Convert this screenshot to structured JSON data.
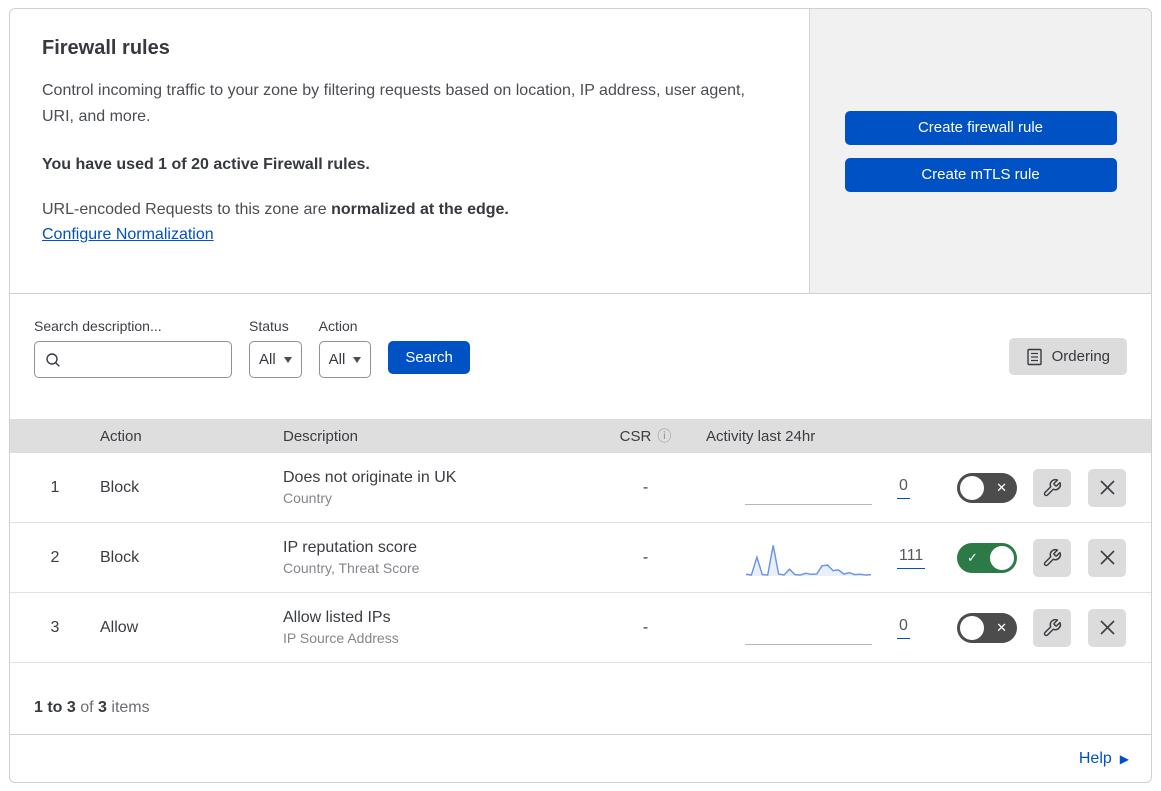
{
  "header": {
    "title": "Firewall rules",
    "description": "Control incoming traffic to your zone by filtering requests based on location, IP address, user agent, URI, and more.",
    "usage": "You have used 1 of 20 active Firewall rules.",
    "normalization_prefix": "URL-encoded Requests to this zone are",
    "normalization_bold": "normalized at the edge.",
    "normalization_link": "Configure Normalization",
    "create_firewall_button": "Create firewall rule",
    "create_mtls_button": "Create mTLS rule"
  },
  "filters": {
    "search_label": "Search description...",
    "search_value": "",
    "status_label": "Status",
    "status_value": "All",
    "action_label": "Action",
    "action_value": "All",
    "search_button": "Search",
    "ordering_button": "Ordering"
  },
  "table": {
    "columns": {
      "action": "Action",
      "description": "Description",
      "csr": "CSR",
      "activity": "Activity last 24hr"
    },
    "rows": [
      {
        "index": "1",
        "action": "Block",
        "description": "Does not originate in UK",
        "fields": "Country",
        "csr": "-",
        "activity_count": "0",
        "enabled": false,
        "sparkline": []
      },
      {
        "index": "2",
        "action": "Block",
        "description": "IP reputation score",
        "fields": "Country, Threat Score",
        "csr": "-",
        "activity_count": "111",
        "enabled": true,
        "sparkline": [
          5,
          3,
          55,
          4,
          3,
          90,
          6,
          3,
          20,
          4,
          3,
          8,
          5,
          6,
          30,
          32,
          16,
          18,
          6,
          10,
          4,
          5,
          3,
          4
        ]
      },
      {
        "index": "3",
        "action": "Allow",
        "description": "Allow listed IPs",
        "fields": "IP Source Address",
        "csr": "-",
        "activity_count": "0",
        "enabled": false,
        "sparkline": []
      }
    ]
  },
  "footer": {
    "range": "1 to 3",
    "of": "of",
    "total": "3",
    "items": "items",
    "help": "Help"
  },
  "icons": {
    "search": "magnifier-icon",
    "ordering": "list-document-icon",
    "info": "ⓘ",
    "toggle_check_glyph": "✓",
    "toggle_x_glyph": "✕",
    "wrench": "wrench-icon",
    "delete": "x-icon",
    "help_arrow": "▶"
  },
  "colors": {
    "accent_blue": "#0051c3",
    "toggle_on_green": "#2c7b46",
    "toggle_off_gray": "#4c4c4c",
    "spark_stroke": "#6e96e8",
    "spark_fill": "#e9effb",
    "flatline_gray": "#b7b7b7",
    "table_header_bg": "#dedede",
    "side_panel_gray": "#f1f1f1"
  }
}
